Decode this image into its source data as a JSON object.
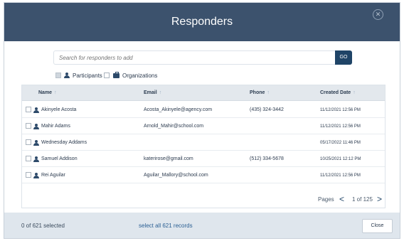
{
  "modal": {
    "title": "Responders",
    "close_icon": "close-icon"
  },
  "search": {
    "placeholder": "Search for responders to add",
    "button_label": "GO"
  },
  "filters": {
    "participants_label": "Participants",
    "participants_checked": true,
    "organizations_label": "Organizations",
    "organizations_checked": false
  },
  "table": {
    "columns": [
      "Name",
      "Email",
      "Phone",
      "Created Date"
    ],
    "sort_icon": "↑",
    "rows": [
      {
        "name": "Akinyele Acosta",
        "email": "Acosta_Akinyele@agency.com",
        "phone": "(435) 324-3442",
        "created": "11/12/2021 12:56 PM"
      },
      {
        "name": "Mahir Adams",
        "email": "Arnold_Mahir@school.com",
        "phone": "",
        "created": "11/12/2021 12:56 PM"
      },
      {
        "name": "Wednesday Addams",
        "email": "",
        "phone": "",
        "created": "05/17/2022 11:46 PM"
      },
      {
        "name": "Samuel Addison",
        "email": "katerirose@gmail.com",
        "phone": "(512) 334-5678",
        "created": "10/25/2021 12:12 PM"
      },
      {
        "name": "Rei Aguilar",
        "email": "Aguilar_Mallory@school.com",
        "phone": "",
        "created": "11/12/2021 12:56 PM"
      }
    ]
  },
  "pagination": {
    "label": "Pages",
    "prev": "<",
    "status": "1 of 125",
    "next": ">"
  },
  "footer": {
    "selected_text": "0 of 621 selected",
    "select_all_text": "select all 621 records",
    "close_label": "Close"
  },
  "colors": {
    "header_bg": "#3c526d",
    "go_button": "#1f4467",
    "footer_bg": "#dfe6ed",
    "link": "#2a5f93"
  }
}
